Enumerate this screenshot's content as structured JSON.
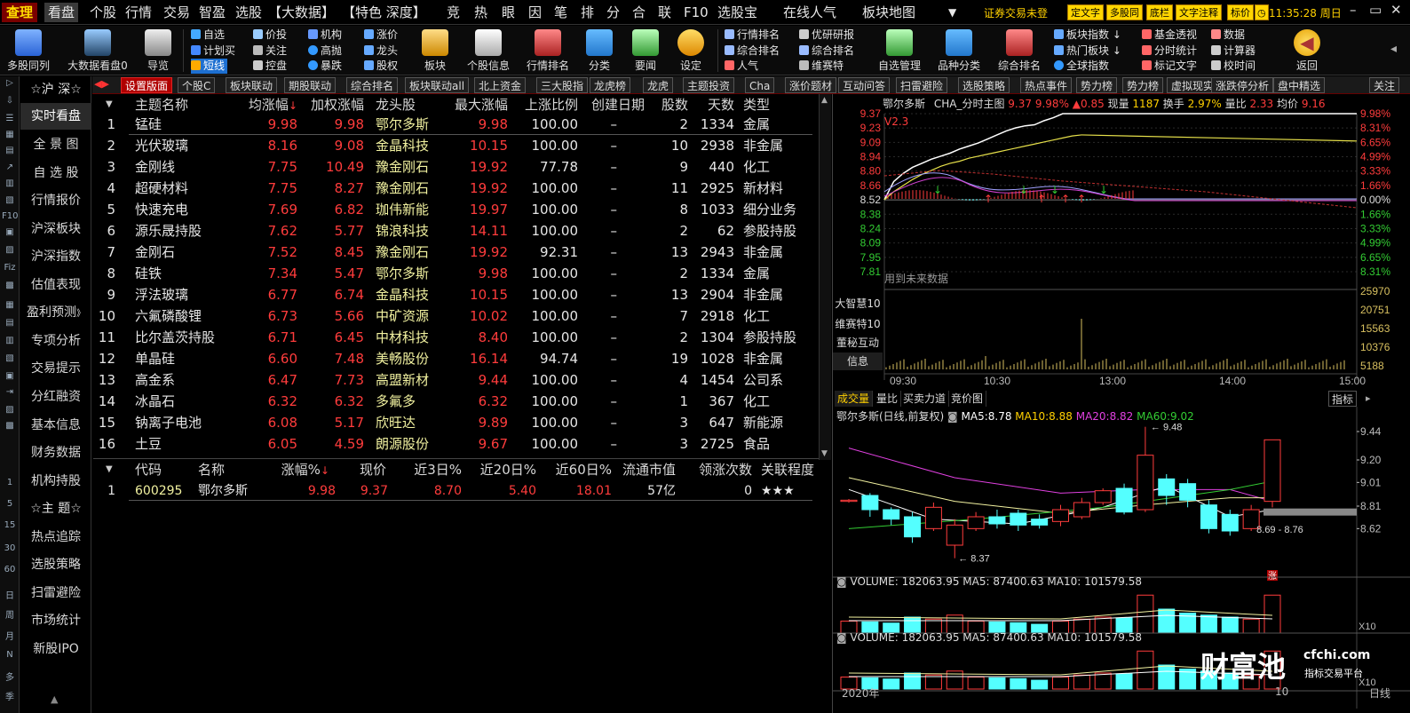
{
  "menubar": {
    "logo": "查理",
    "items": [
      "看盘",
      "个股",
      "行情",
      "交易",
      "智盈",
      "选股",
      "【大数据】",
      "【特色 深度】",
      "竞",
      "热",
      "眼",
      "因",
      "笔",
      "排",
      "分",
      "合",
      "联",
      "F10",
      "选股宝",
      "在线人气",
      "板块地图"
    ],
    "warning": "证券交易未登",
    "yellow_buttons": [
      "定文字",
      "多股同",
      "底栏",
      "文字注释",
      "标价"
    ],
    "clock": "11:35:28 周日"
  },
  "toolbar": {
    "big_buttons": [
      "多股同列",
      "大数据看盘0",
      "导览",
      "板块",
      "个股信息",
      "行情排名",
      "分类",
      "要闻",
      "设定",
      "自选管理",
      "品种分类",
      "综合排名",
      "返回"
    ],
    "small_buttons": {
      "col1": [
        "自选",
        "计划买",
        "短线"
      ],
      "col2": [
        "价投",
        "关注",
        "控盘"
      ],
      "col3": [
        "机构",
        "高抛",
        "暴跌"
      ],
      "col4": [
        "涨价",
        "龙头",
        "股权"
      ],
      "col5": [
        "行情排名",
        "综合排名",
        "人气"
      ],
      "col6": [
        "优研研报",
        "综合排名",
        "维赛特"
      ],
      "col7": [
        "板块指数",
        "热门板块",
        "全球指数"
      ],
      "col8": [
        "基金透视",
        "分时统计",
        "标记文字"
      ],
      "col9": [
        "数据",
        "计算器",
        "校时间"
      ]
    }
  },
  "iconstrip": [
    "▷",
    "⇩",
    "☰",
    "▦",
    "▤",
    "↗",
    "▥",
    "▧",
    "F10",
    "▣",
    "▨",
    "Fiz",
    "▩",
    "▦",
    "▤",
    "▥",
    "▧",
    "▣",
    "⇥",
    "▨",
    "▩",
    "1",
    "5",
    "15",
    "30",
    "60",
    "日",
    "周",
    "月",
    "N",
    "多",
    "季"
  ],
  "leftnav": {
    "header": "☆沪 深☆",
    "items": [
      "实时看盘",
      "全 景 图",
      "自 选 股",
      "行情报价",
      "沪深板块",
      "沪深指数",
      "估值表现",
      "盈利预测",
      "专项分析",
      "交易提示",
      "分红融资",
      "基本信息",
      "财务数据",
      "机构持股"
    ],
    "header2": "☆主 题☆",
    "items2": [
      "热点追踪",
      "选股策略",
      "扫雷避险",
      "市场统计",
      "新股IPO"
    ]
  },
  "tabs": [
    "设置版面",
    "个股C",
    "板块联动",
    "期股联动",
    "综合排名",
    "板块联动all",
    "北上资金",
    "三大股指",
    "龙虎榜",
    "龙虎",
    "主题投资",
    "Cha",
    "涨价题材",
    "互动问答",
    "扫雷避险",
    "选股策略",
    "热点事件",
    "势力榜",
    "势力榜",
    "虚拟现实",
    "涨跌停分析",
    "盘中精选",
    "关注"
  ],
  "theme_table": {
    "headers": [
      "主题名称",
      "均涨幅",
      "加权涨幅",
      "龙头股",
      "最大涨幅",
      "上涨比例",
      "创建日期",
      "股数",
      "天数",
      "类型"
    ],
    "rows": [
      [
        "1",
        "锰硅",
        "9.98",
        "9.98",
        "鄂尔多斯",
        "9.98",
        "100.00",
        "–",
        "2",
        "1334",
        "金属"
      ],
      [
        "2",
        "光伏玻璃",
        "8.16",
        "9.08",
        "金晶科技",
        "10.15",
        "100.00",
        "–",
        "10",
        "2938",
        "非金属"
      ],
      [
        "3",
        "金刚线",
        "7.75",
        "10.49",
        "豫金刚石",
        "19.92",
        "77.78",
        "–",
        "9",
        "440",
        "化工"
      ],
      [
        "4",
        "超硬材料",
        "7.75",
        "8.27",
        "豫金刚石",
        "19.92",
        "100.00",
        "–",
        "11",
        "2925",
        "新材料"
      ],
      [
        "5",
        "快速充电",
        "7.69",
        "6.82",
        "珈伟新能",
        "19.97",
        "100.00",
        "–",
        "8",
        "1033",
        "细分业务"
      ],
      [
        "6",
        "源乐晟持股",
        "7.62",
        "5.77",
        "锦浪科技",
        "14.11",
        "100.00",
        "–",
        "2",
        "62",
        "参股持股"
      ],
      [
        "7",
        "金刚石",
        "7.52",
        "8.45",
        "豫金刚石",
        "19.92",
        "92.31",
        "–",
        "13",
        "2943",
        "非金属"
      ],
      [
        "8",
        "硅铁",
        "7.34",
        "5.47",
        "鄂尔多斯",
        "9.98",
        "100.00",
        "–",
        "2",
        "1334",
        "金属"
      ],
      [
        "9",
        "浮法玻璃",
        "6.77",
        "6.74",
        "金晶科技",
        "10.15",
        "100.00",
        "–",
        "13",
        "2904",
        "非金属"
      ],
      [
        "10",
        "六氟磷酸锂",
        "6.73",
        "5.66",
        "中矿资源",
        "10.02",
        "100.00",
        "–",
        "7",
        "2918",
        "化工"
      ],
      [
        "11",
        "比尔盖茨持股",
        "6.71",
        "6.45",
        "中材科技",
        "8.40",
        "100.00",
        "–",
        "2",
        "1304",
        "参股持股"
      ],
      [
        "12",
        "单晶硅",
        "6.60",
        "7.48",
        "美畅股份",
        "16.14",
        "94.74",
        "–",
        "19",
        "1028",
        "非金属"
      ],
      [
        "13",
        "高金系",
        "6.47",
        "7.73",
        "高盟新材",
        "9.44",
        "100.00",
        "–",
        "4",
        "1454",
        "公司系"
      ],
      [
        "14",
        "冰晶石",
        "6.32",
        "6.32",
        "多氟多",
        "6.32",
        "100.00",
        "–",
        "1",
        "367",
        "化工"
      ],
      [
        "15",
        "钠离子电池",
        "6.08",
        "5.17",
        "欣旺达",
        "9.89",
        "100.00",
        "–",
        "3",
        "647",
        "新能源"
      ],
      [
        "16",
        "土豆",
        "6.05",
        "4.59",
        "朗源股份",
        "9.67",
        "100.00",
        "–",
        "3",
        "2725",
        "食品"
      ]
    ]
  },
  "stock_table": {
    "headers": [
      "代码",
      "名称",
      "涨幅%",
      "现价",
      "近3日%",
      "近20日%",
      "近60日%",
      "流通市值",
      "领涨次数",
      "关联程度"
    ],
    "rows": [
      [
        "1",
        "600295",
        "鄂尔多斯",
        "9.98",
        "9.37",
        "8.70",
        "5.40",
        "18.01",
        "57亿",
        "0",
        "★★★"
      ]
    ]
  },
  "intraday": {
    "title_name": "鄂尔多斯",
    "title_chart": "CHA_分时主图",
    "price": "9.37",
    "pct": "9.98%",
    "change": "▲0.85",
    "volume_label": "现量",
    "volume": "1187",
    "turnover_label": "换手",
    "turnover": "2.97%",
    "ratio_label": "量比",
    "ratio": "2.33",
    "avg_label": "均价",
    "avg": "9.16",
    "v_label": "V2.3",
    "left_axis": [
      "9.37",
      "9.23",
      "9.09",
      "8.94",
      "8.80",
      "8.66",
      "8.52",
      "8.38",
      "8.24",
      "8.09",
      "7.95",
      "7.81"
    ],
    "right_axis": [
      "9.98%",
      "8.31%",
      "6.65%",
      "4.99%",
      "3.33%",
      "1.66%",
      "0.00%",
      "1.66%",
      "3.33%",
      "4.99%",
      "6.65%",
      "8.31%"
    ],
    "future_text": "用到未来数据",
    "vol_axis": [
      "25970",
      "20751",
      "15563",
      "10376",
      "5188"
    ],
    "time_axis": [
      "09:30",
      "10:30",
      "13:00",
      "14:00",
      "15:00"
    ],
    "side_labels": [
      "大智慧10",
      "维赛特10",
      "董秘互动",
      "信息"
    ],
    "price_line": [
      8.52,
      8.7,
      8.78,
      8.84,
      8.88,
      8.92,
      8.95,
      8.98,
      9.02,
      9.05,
      9.08,
      9.12,
      9.16,
      9.2,
      9.23,
      9.25,
      9.26,
      9.3,
      9.33,
      9.37,
      9.37,
      9.37
    ],
    "avg_line": [
      8.52,
      8.6,
      8.66,
      8.72,
      8.77,
      8.81,
      8.85,
      8.88,
      8.9,
      8.93,
      8.95,
      8.97,
      8.99,
      9.01,
      9.03,
      9.05,
      9.07,
      9.09,
      9.11,
      9.13,
      9.15,
      9.16
    ]
  },
  "kline": {
    "subtabs": [
      "成交量",
      "量比",
      "买卖力道",
      "竞价图"
    ],
    "indicator_btn": "指标",
    "title": "鄂尔多斯(日线,前复权)",
    "ma5_label": "MA5:",
    "ma5": "8.78",
    "ma10_label": "MA10:",
    "ma10": "8.88",
    "ma20_label": "MA20:",
    "ma20": "8.82",
    "ma60_label": "MA60:",
    "ma60": "9.02",
    "high_label": "9.48",
    "low_label": "8.37",
    "range_label": "8.69 - 8.76",
    "zhang_label": "涨",
    "axis": [
      "9.44",
      "9.20",
      "9.01",
      "8.81",
      "8.62"
    ],
    "volume1": "VOLUME: 182063.95 MA5: 87400.63 MA10: 101579.58",
    "volume2": "VOLUME: 182063.95 MA5: 87400.63 MA10: 101579.58",
    "x10": "X10",
    "year": "2020年",
    "month": "10",
    "period": "日线",
    "candles": [
      {
        "o": 8.85,
        "c": 8.86,
        "h": 8.87,
        "l": 8.84
      },
      {
        "o": 8.9,
        "c": 8.78,
        "h": 8.92,
        "l": 8.72
      },
      {
        "o": 8.78,
        "c": 8.7,
        "h": 8.8,
        "l": 8.65
      },
      {
        "o": 8.72,
        "c": 8.55,
        "h": 8.76,
        "l": 8.5
      },
      {
        "o": 8.62,
        "c": 8.8,
        "h": 8.84,
        "l": 8.6
      },
      {
        "o": 8.48,
        "c": 8.65,
        "h": 8.7,
        "l": 8.37
      },
      {
        "o": 8.62,
        "c": 8.72,
        "h": 8.76,
        "l": 8.6
      },
      {
        "o": 8.72,
        "c": 8.66,
        "h": 8.78,
        "l": 8.62
      },
      {
        "o": 8.75,
        "c": 8.65,
        "h": 8.78,
        "l": 8.6
      },
      {
        "o": 8.7,
        "c": 8.65,
        "h": 8.74,
        "l": 8.62
      },
      {
        "o": 8.68,
        "c": 8.78,
        "h": 8.82,
        "l": 8.64
      },
      {
        "o": 8.72,
        "c": 8.84,
        "h": 8.88,
        "l": 8.7
      },
      {
        "o": 8.84,
        "c": 8.94,
        "h": 8.96,
        "l": 8.82
      },
      {
        "o": 8.96,
        "c": 8.76,
        "h": 9.0,
        "l": 8.74
      },
      {
        "o": 8.78,
        "c": 9.24,
        "h": 9.48,
        "l": 8.76
      },
      {
        "o": 9.04,
        "c": 8.9,
        "h": 9.08,
        "l": 8.82
      },
      {
        "o": 9.0,
        "c": 8.86,
        "h": 9.04,
        "l": 8.8
      },
      {
        "o": 8.82,
        "c": 8.62,
        "h": 8.86,
        "l": 8.58
      },
      {
        "o": 8.74,
        "c": 8.6,
        "h": 8.78,
        "l": 8.56
      },
      {
        "o": 8.62,
        "c": 8.78,
        "h": 8.82,
        "l": 8.6
      },
      {
        "o": 8.85,
        "c": 9.37,
        "h": 9.37,
        "l": 8.8
      }
    ],
    "volumes": [
      30,
      28,
      25,
      40,
      35,
      45,
      30,
      28,
      26,
      22,
      30,
      35,
      40,
      38,
      95,
      60,
      50,
      45,
      40,
      35,
      95
    ]
  },
  "watermark": {
    "main": "财富池",
    "site": "cfchi.com",
    "sub": "指标交易平台"
  },
  "colors": {
    "up": "#ff3c3c",
    "down": "#54ffff",
    "yellow": "#f2f2a0",
    "accent": "#ffd000",
    "tab_active": "#b00000"
  }
}
